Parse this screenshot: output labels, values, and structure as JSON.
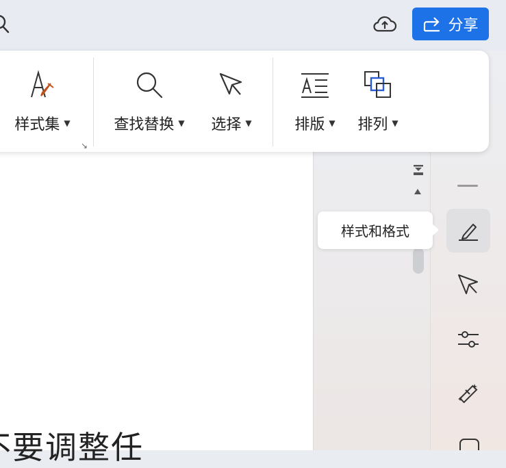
{
  "topbar": {
    "share_label": "分享"
  },
  "ribbon": {
    "tools": [
      {
        "label": "样式集"
      },
      {
        "label": "查找替换"
      },
      {
        "label": "选择"
      },
      {
        "label": "排版"
      },
      {
        "label": "排列"
      }
    ]
  },
  "tooltip": {
    "text": "样式和格式"
  },
  "document": {
    "visible_text": "不要调整任"
  },
  "colors": {
    "accent": "#1d72e8",
    "icon_brush": "#c0531d",
    "arrange_front": "#2a5bd7"
  },
  "icons": [
    "search-icon",
    "cloud-upload-icon",
    "share-icon",
    "style-set-icon",
    "find-replace-icon",
    "select-icon",
    "typesetting-icon",
    "arrange-icon",
    "collapse-icon",
    "scroll-up-icon",
    "style-format-icon",
    "select-panel-icon",
    "adjust-icon",
    "magic-wand-icon"
  ]
}
